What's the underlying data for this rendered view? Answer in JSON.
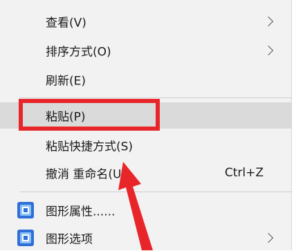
{
  "context_menu": {
    "items": [
      {
        "label": "查看(V)",
        "has_submenu": true
      },
      {
        "label": "排序方式(O)",
        "has_submenu": true
      },
      {
        "label": "刷新(E)",
        "has_submenu": false
      },
      {
        "label": "粘贴(P)",
        "has_submenu": false,
        "highlighted": true
      },
      {
        "label": "粘贴快捷方式(S)",
        "has_submenu": false
      },
      {
        "label": "撤消 重命名(U)",
        "shortcut": "Ctrl+Z",
        "has_submenu": false
      },
      {
        "label": "图形属性......",
        "icon": "graphics-app-icon",
        "has_submenu": false
      },
      {
        "label": "图形选项",
        "icon": "graphics-app-icon",
        "has_submenu": true
      }
    ]
  },
  "annotation": {
    "color": "#e8262a",
    "target": "粘贴(P)"
  },
  "colors": {
    "menu_background": "#f2f2f2",
    "highlight": "#dadada",
    "annotation_red": "#e8262a",
    "icon_blue": "#2f6fd8"
  }
}
